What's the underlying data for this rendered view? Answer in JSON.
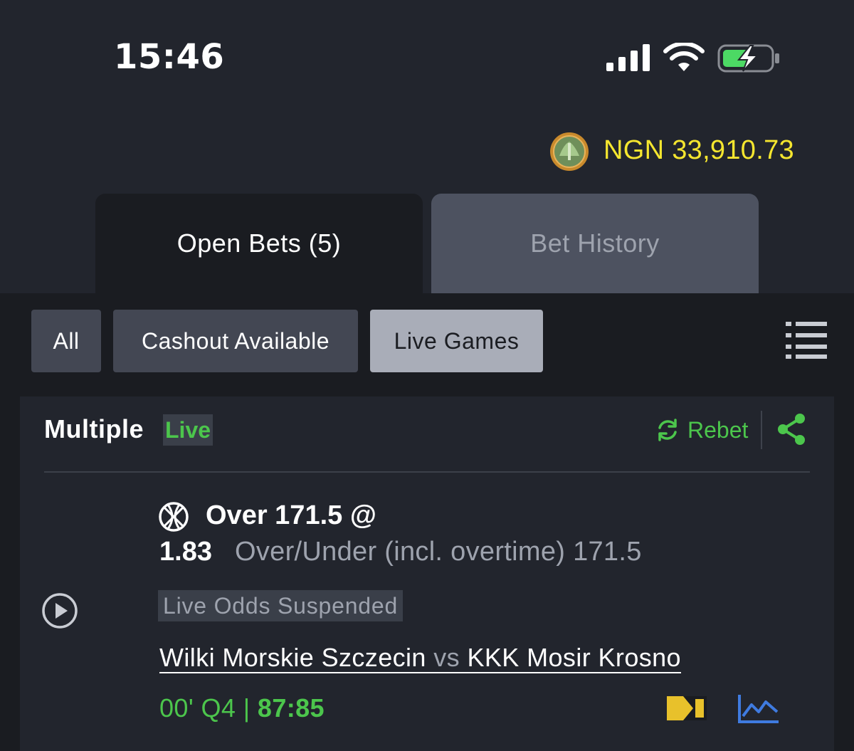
{
  "status_bar": {
    "time": "15:46",
    "icons": [
      "cellular-signal-icon",
      "wifi-icon",
      "battery-charging-icon"
    ]
  },
  "balance": {
    "amount": "NGN 33,910.73",
    "icon": "coin-icon",
    "color": "#f5e62f"
  },
  "tabs": [
    {
      "label": "Open Bets (5)",
      "active": true
    },
    {
      "label": "Bet History",
      "active": false
    }
  ],
  "filters": [
    {
      "label": "All",
      "selected": false
    },
    {
      "label": "Cashout Available",
      "selected": false
    },
    {
      "label": "Live Games",
      "selected": true
    }
  ],
  "bet": {
    "type": "Multiple",
    "badge": "Live",
    "rebet_label": "Rebet",
    "selection": "Over 171.5 @",
    "odds": "1.83",
    "market": "Over/Under (incl. overtime) 171.5",
    "status": "Live Odds Suspended",
    "home_team": "Wilki Morskie Szczecin",
    "vs": "vs",
    "away_team": "KKK Mosir Krosno",
    "game_time": "00' Q4 |",
    "score": "87:85",
    "sport_icon": "basketball-icon"
  },
  "colors": {
    "accent_green": "#4cc64c",
    "background": "#22252d",
    "panel": "#1a1c21",
    "tracker_yellow": "#e8c12b",
    "stats_blue": "#3f7be0"
  }
}
